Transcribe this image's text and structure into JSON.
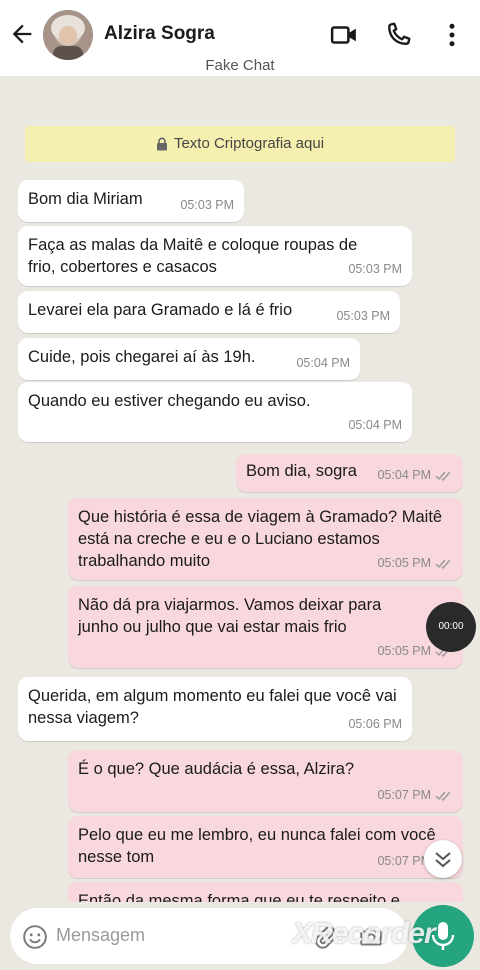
{
  "header": {
    "contact_name": "Alzira Sogra",
    "subtitle": "Fake Chat"
  },
  "chat": {
    "encryption_notice": "Texto Criptografia aqui",
    "messages": [
      {
        "dir": "in",
        "text": "Bom dia Miriam",
        "time": "05:03 PM"
      },
      {
        "dir": "in",
        "text": "Faça as malas da Maitê e coloque roupas de frio, cobertores e casacos",
        "time": "05:03 PM"
      },
      {
        "dir": "in",
        "text": "Levarei ela para Gramado e lá é frio",
        "time": "05:03 PM"
      },
      {
        "dir": "in",
        "text": "Cuide, pois chegarei aí às 19h.",
        "time": "05:04 PM"
      },
      {
        "dir": "in",
        "text": "Quando eu estiver chegando eu aviso.",
        "time": "05:04 PM"
      },
      {
        "dir": "out",
        "text": "Bom dia, sogra",
        "time": "05:04 PM"
      },
      {
        "dir": "out",
        "text": "Que história é essa de viagem à Gramado? Maitê está na creche e eu e o Luciano estamos trabalhando muito",
        "time": "05:05 PM"
      },
      {
        "dir": "out",
        "text": "Não dá pra viajarmos. Vamos deixar para junho ou julho que vai estar mais frio",
        "time": "05:05 PM"
      },
      {
        "dir": "in",
        "text": "Querida, em algum momento eu falei que você vai nessa viagem?",
        "time": "05:06 PM"
      },
      {
        "dir": "out",
        "text": "É o que? Que audácia é essa, Alzira?",
        "time": "05:07 PM"
      },
      {
        "dir": "out",
        "text": "Pelo que eu me lembro, eu nunca falei com você nesse tom",
        "time": "05:07 PM"
      },
      {
        "dir": "out",
        "text": "Então da mesma forma que eu te respeito e",
        "time": ""
      }
    ],
    "recording_timer": "00:00"
  },
  "input": {
    "placeholder": "Mensagem"
  },
  "watermark": "XRecorder",
  "colors": {
    "incoming_bubble": "#ffffff",
    "outgoing_bubble": "#f8d7dd",
    "encryption_banner": "#f6f0b0",
    "send_button": "#24a57f"
  },
  "icons": [
    "back-arrow-icon",
    "video-call-icon",
    "phone-icon",
    "more-vertical-icon",
    "lock-icon",
    "double-check-icon",
    "chevrons-down-icon",
    "emoji-icon",
    "attach-icon",
    "camera-icon",
    "mic-icon"
  ]
}
